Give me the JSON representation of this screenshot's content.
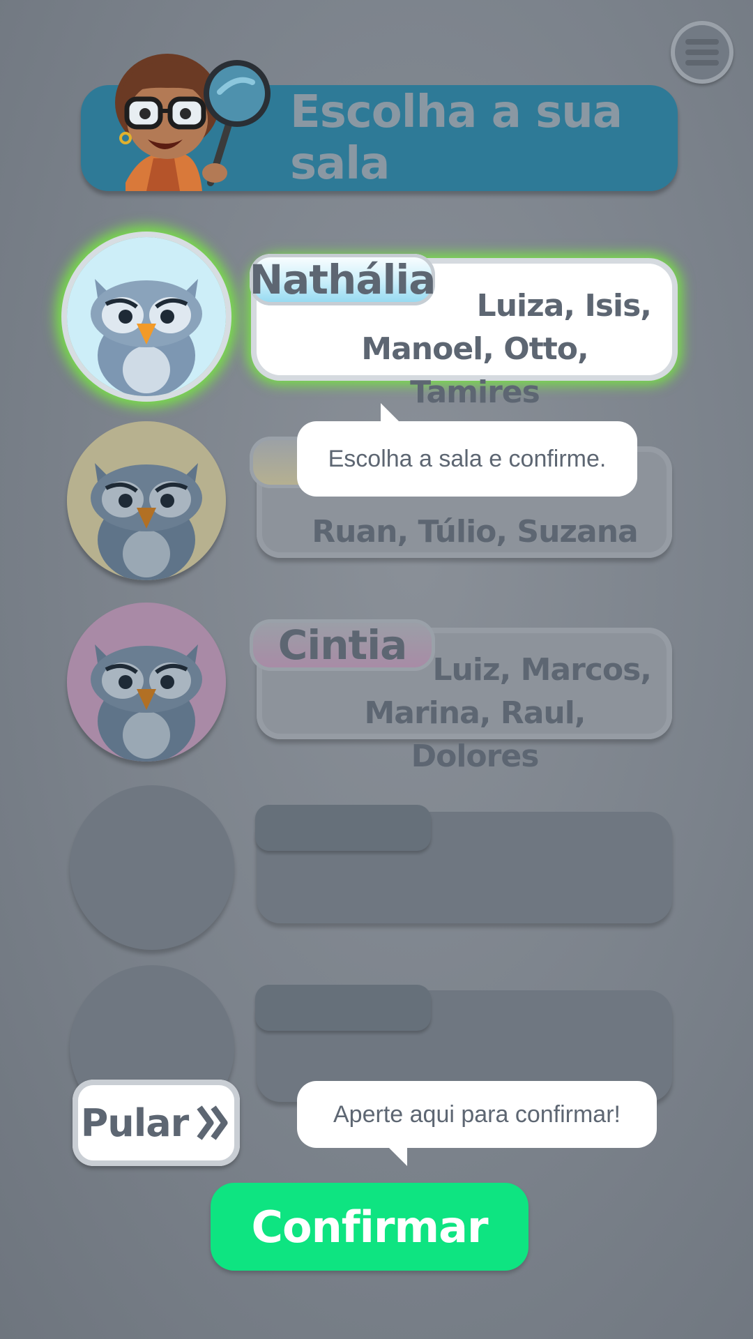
{
  "header": {
    "title": "Escolha a sua sala"
  },
  "menu": {
    "icon": "hamburger-menu-icon"
  },
  "classes": [
    {
      "teacher": "Nathália",
      "students_line1": "Luiza, Isis,",
      "students_line2": "Manoel, Otto, Tamires",
      "color": "#bfe9f7",
      "selected": true
    },
    {
      "teacher": "",
      "students_line1": "",
      "students_line2": "Ruan, Túlio, Suzana",
      "color": "#b7b18f",
      "selected": false
    },
    {
      "teacher": "Cintia",
      "students_line1": "Luiz, Marcos,",
      "students_line2": "Marina, Raul, Dolores",
      "color": "#a98aa6",
      "selected": false
    }
  ],
  "tooltips": {
    "choose": "Escolha a sala e confirme.",
    "confirm_hint": "Aperte aqui para confirmar!"
  },
  "buttons": {
    "skip_label": "Pular",
    "skip_icon": "double-chevron-right-icon",
    "confirm_label": "Confirmar"
  },
  "colors": {
    "accent_confirm": "#0ee481",
    "banner": "#2e7a97",
    "highlight": "#78f03c"
  }
}
